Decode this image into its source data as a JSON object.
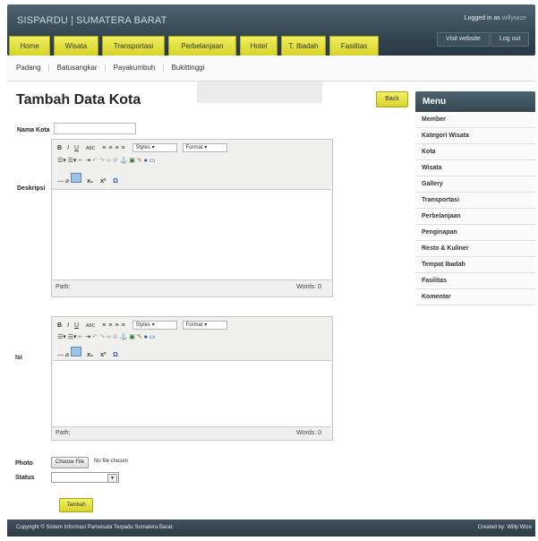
{
  "header": {
    "brand": "SISPARDU",
    "brand_sub": "SUMATERA BARAT",
    "brand_sep": "|",
    "logged_prefix": "Logged in as",
    "logged_user": "willywize",
    "visit_label": "Visit website",
    "logout_label": "Log out"
  },
  "nav": {
    "tabs": [
      {
        "label": "Home",
        "width": 46
      },
      {
        "label": "Wisata",
        "width": 50
      },
      {
        "label": "Transportasi",
        "width": 70
      },
      {
        "label": "Perbelanjaan",
        "width": 76
      },
      {
        "label": "Hotel",
        "width": 42
      },
      {
        "label": "T. Ibadah",
        "width": 50
      },
      {
        "label": "Fasilitas",
        "width": 55
      }
    ]
  },
  "subnav": {
    "items": [
      "Padang",
      "Batusangkar",
      "Payakumbuh",
      "Bukittinggi"
    ]
  },
  "page": {
    "title": "Tambah Data Kota",
    "back_label": "Back"
  },
  "form": {
    "nama_label": "Nama Kota",
    "nama_value": "",
    "deskripsi_label": "Deskripsi",
    "isi_label": "Isi",
    "photo_label": "Photo",
    "status_label": "Status",
    "file_button": "Choose File",
    "file_text": "No file chosen",
    "status_value": "",
    "submit_label": "Tambah"
  },
  "editor": {
    "styles_label": "Styles",
    "format_label": "Format",
    "path_label": "Path:",
    "words_label": "Words: 0",
    "omega": "Ω",
    "sub_label": "x",
    "sup_label": "x"
  },
  "sidebar": {
    "title": "Menu",
    "items": [
      "Member",
      "Kategori Wisata",
      "Kota",
      "Wisata",
      "Gallery",
      "Transportasi",
      "Perbelanjaan",
      "Penginapan",
      "Resto & Kuliner",
      "Tempat Ibadah",
      "Fasilitas",
      "Komentar"
    ]
  },
  "footer": {
    "copyright": "Copyright © Sistem Informasi Pariwisata Terpadu Sumatera Barat.",
    "created": "Created by: Willy Wize"
  },
  "colors": {
    "accent": "#e6e33c",
    "header": "#34474f"
  }
}
